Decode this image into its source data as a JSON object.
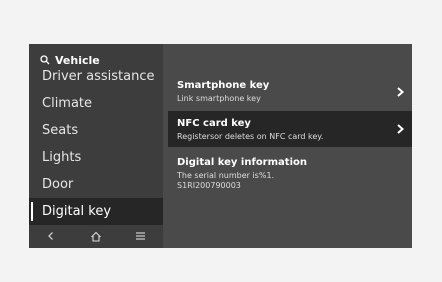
{
  "sidebar": {
    "header": "Vehicle",
    "items": [
      {
        "label": "Driver assistance"
      },
      {
        "label": "Climate"
      },
      {
        "label": "Seats"
      },
      {
        "label": "Lights"
      },
      {
        "label": "Door"
      },
      {
        "label": "Digital key",
        "active": true
      }
    ],
    "bottom_icons": [
      "back-icon",
      "home-icon",
      "menu-icon"
    ]
  },
  "content": {
    "cards": [
      {
        "title": "Smartphone key",
        "subtitle": "Link smartphone key",
        "chevron": true
      },
      {
        "title": "NFC card key",
        "subtitle": "Registersor deletes on NFC card key.",
        "chevron": true,
        "highlighted": true
      },
      {
        "title": "Digital key information",
        "subtitle": "The serial number is%1.\nS1RI200790003",
        "chevron": false
      }
    ]
  },
  "colors": {
    "page_bg": "#f3f3f3",
    "screen_bg": "#4a4a4a",
    "sidebar_bg": "#3d3d3d",
    "active_bg": "#262626",
    "text": "#ffffff"
  }
}
